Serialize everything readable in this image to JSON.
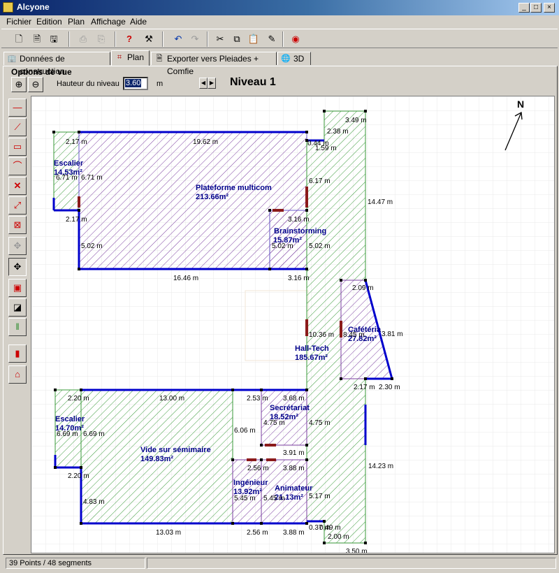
{
  "window": {
    "title": "Alcyone"
  },
  "menu": [
    "Fichier",
    "Edition",
    "Plan",
    "Affichage",
    "Aide"
  ],
  "tabs": [
    "Données de construction",
    "Plan",
    "Exporter vers Pleiades + Comfie",
    "3D"
  ],
  "view_options": {
    "group_label": "Options de vue",
    "height_label": "Hauteur du niveau",
    "height_value": "3.60",
    "unit": "m",
    "level": "Niveau 1"
  },
  "plan": {
    "north": "N",
    "rooms": [
      {
        "name": "Escalier",
        "area": "14.53m²"
      },
      {
        "name": "Plateforme multicom",
        "area": "213.66m²"
      },
      {
        "name": "Brainstorming",
        "area": "15.87m²"
      },
      {
        "name": "Cafétéria",
        "area": "27.82m²"
      },
      {
        "name": "Hall-Tech",
        "area": "185.67m²"
      },
      {
        "name": "Escalier",
        "area": "14.70m²"
      },
      {
        "name": "Vide sur sémimaire",
        "area": "149.83m²"
      },
      {
        "name": "Secrétariat",
        "area": "18.52m²"
      },
      {
        "name": "Ingénieur",
        "area": "13.92m²"
      },
      {
        "name": "Animateur",
        "area": "21.13m²"
      }
    ],
    "dimensions": [
      "2.17 m",
      "19.62 m",
      "0.44 m",
      "1.59 m",
      "2.38 m",
      "3.49 m",
      "6.71 m",
      "6.71 m",
      "6.17 m",
      "14.47 m",
      "2.17 m",
      "3.16 m",
      "5.02 m",
      "5.02 m",
      "5.02 m",
      "16.46 m",
      "3.16 m",
      "2.09 m",
      "10.36 m",
      "8.45 m",
      "3.81 m",
      "2.17 m",
      "2.30 m",
      "2.20 m",
      "13.00 m",
      "2.53 m",
      "3.68 m",
      "6.06 m",
      "4.75 m",
      "4.75 m",
      "6.69 m",
      "6.69 m",
      "3.91 m",
      "2.56 m",
      "3.88 m",
      "14.23 m",
      "2.20 m",
      "5.45 m",
      "5.45 m",
      "5.17 m",
      "4.83 m",
      "0.37 m",
      "0.49 m",
      "2.00 m",
      "13.03 m",
      "2.56 m",
      "3.88 m",
      "3.50 m"
    ]
  },
  "status": {
    "points_segments": "39 Points / 48 segments",
    "extra": ""
  },
  "colors": {
    "titlebar": "#0a246a",
    "wall": "#0000cc",
    "door": "#8b1a1a",
    "hatch_green": "#3a9a3a",
    "hatch_violet": "#7b3fa0",
    "label": "#00008b"
  }
}
